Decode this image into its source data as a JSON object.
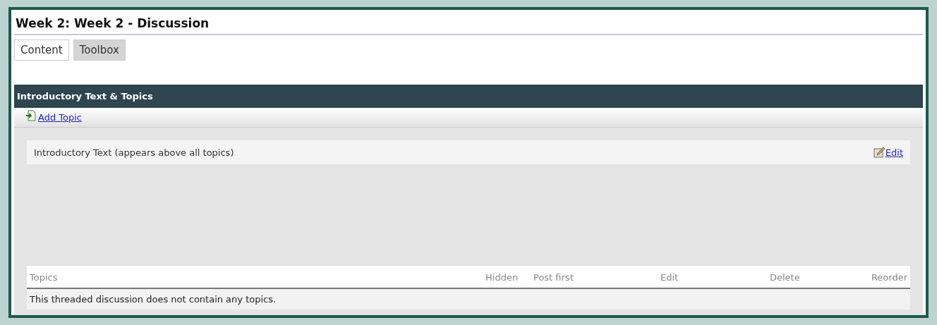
{
  "page": {
    "title": "Week 2: Week 2 - Discussion"
  },
  "tabs": [
    {
      "label": "Content",
      "selected": true
    },
    {
      "label": "Toolbox",
      "selected": false
    }
  ],
  "section": {
    "title": "Introductory Text & Topics",
    "add_link": "Add Topic",
    "intro_text": "Introductory Text (appears above all topics)",
    "intro_edit": "Edit"
  },
  "table": {
    "columns": [
      "Topics",
      "Hidden",
      "Post first",
      "Edit",
      "Delete",
      "Reorder"
    ],
    "empty_message": "This threaded discussion does not contain any topics."
  }
}
